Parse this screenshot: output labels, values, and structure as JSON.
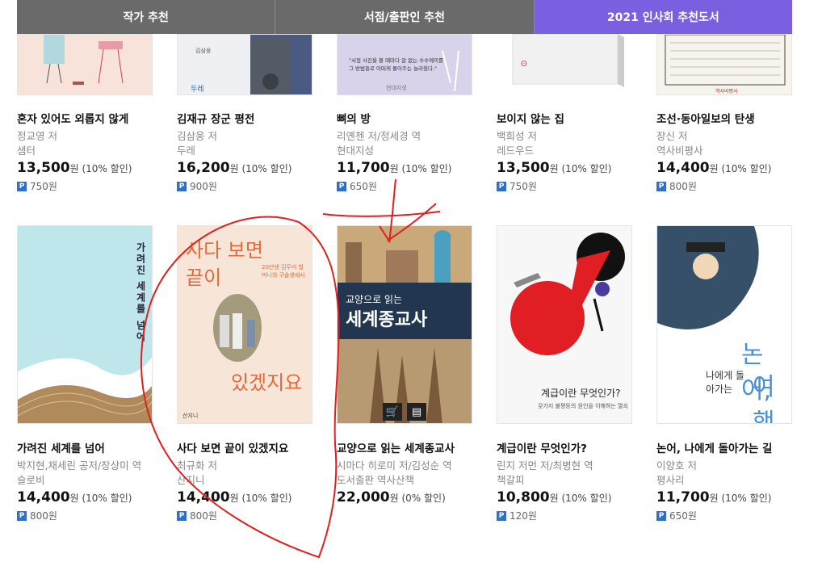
{
  "tabs": [
    {
      "label": "작가 추천"
    },
    {
      "label": "서점/출판인 추천"
    },
    {
      "label": "2021 인사회 추천도서"
    }
  ],
  "colors": {
    "active_tab": "#7a5fe0",
    "inactive_tab": "#6a6a6a",
    "points_badge": "#2f6fc8",
    "annotation": "#e02020"
  },
  "row1": [
    {
      "title": "혼자 있어도 외롭지 않게",
      "author": "정교영 저",
      "publisher": "샘터",
      "price": "13,500",
      "won": "원",
      "discount": "(10% 할인)",
      "points": "750원"
    },
    {
      "title": "김재규 장군 평전",
      "author": "김삼웅 저",
      "publisher": "두레",
      "price": "16,200",
      "won": "원",
      "discount": "(10% 할인)",
      "points": "900원"
    },
    {
      "title": "뼈의 방",
      "author": "리옌첸 저/정세경 역",
      "publisher": "현대지성",
      "price": "11,700",
      "won": "원",
      "discount": "(10% 할인)",
      "points": "650원"
    },
    {
      "title": "보이지 않는 집",
      "author": "백희성 저",
      "publisher": "레드우드",
      "price": "13,500",
      "won": "원",
      "discount": "(10% 할인)",
      "points": "750원"
    },
    {
      "title": "조선·동아일보의 탄생",
      "author": "장신 저",
      "publisher": "역사비평사",
      "price": "14,400",
      "won": "원",
      "discount": "(10% 할인)",
      "points": "800원"
    }
  ],
  "row2": [
    {
      "title": "가려진 세계를 넘어",
      "author": "박지현,채세린 공저/장상미 역",
      "publisher": "슬로비",
      "price": "14,400",
      "won": "원",
      "discount": "(10% 할인)",
      "points": "800원",
      "cover_text": "가려진 세계를 넘어"
    },
    {
      "title": "사다 보면 끝이 있겠지요",
      "author": "최규화 저",
      "publisher": "산지니",
      "price": "14,400",
      "won": "원",
      "discount": "(10% 할인)",
      "points": "800원",
      "cover_text_a": "사다 보면",
      "cover_text_b": "끝이",
      "cover_text_c": "있겠지요",
      "cover_sub": "20년생 김두미 할머니의 구술생애사",
      "cover_pub": "산지니"
    },
    {
      "title": "교양으로 읽는 세계종교사",
      "author": "시마다 히로미 저/김성순 역",
      "publisher": "도서출판 역사산책",
      "price": "22,000",
      "won": "원",
      "discount": "(0% 할인)",
      "points": "",
      "cover_text_a": "교양으로 읽는",
      "cover_text_b": "세계종교사"
    },
    {
      "title": "계급이란 무엇인가?",
      "author": "린지 저먼 저/최병현 역",
      "publisher": "책갈피",
      "price": "10,800",
      "won": "원",
      "discount": "(10% 할인)",
      "points": "120원",
      "cover_text_a": "계급이란 무엇인가?",
      "cover_sub": "갖가지 불평등의 원인을 이해하는 열쇠"
    },
    {
      "title": "논어, 나에게 돌아가는 길",
      "author": "이양호 저",
      "publisher": "평사리",
      "price": "11,700",
      "won": "원",
      "discount": "(10% 할인)",
      "points": "650원",
      "cover_text_a": "논어,",
      "cover_text_b": "나에게 돌아가는",
      "cover_text_c": "여행"
    }
  ],
  "cover_buttons": {
    "cart_icon": "cart-icon",
    "preview_icon": "book-preview-icon"
  }
}
